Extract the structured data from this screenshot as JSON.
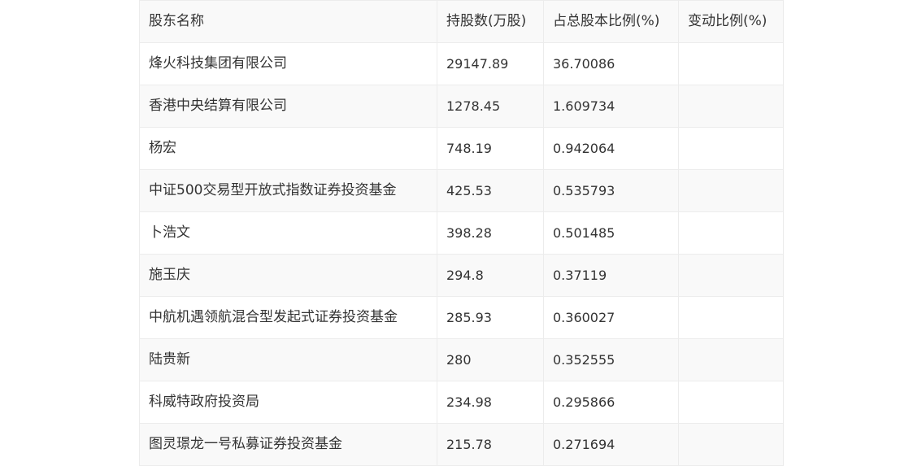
{
  "table": {
    "headers": [
      "股东名称",
      "持股数(万股)",
      "占总股本比例(%)",
      "变动比例(%)"
    ],
    "rows": [
      [
        "烽火科技集团有限公司",
        "29147.89",
        "36.70086",
        ""
      ],
      [
        "香港中央结算有限公司",
        "1278.45",
        "1.609734",
        ""
      ],
      [
        "杨宏",
        "748.19",
        "0.942064",
        ""
      ],
      [
        "中证500交易型开放式指数证券投资基金",
        "425.53",
        "0.535793",
        ""
      ],
      [
        "卜浩文",
        "398.28",
        "0.501485",
        ""
      ],
      [
        "施玉庆",
        "294.8",
        "0.37119",
        ""
      ],
      [
        "中航机遇领航混合型发起式证券投资基金",
        "285.93",
        "0.360027",
        ""
      ],
      [
        "陆贵新",
        "280",
        "0.352555",
        ""
      ],
      [
        "科威特政府投资局",
        "234.98",
        "0.295866",
        ""
      ],
      [
        "图灵璟龙一号私募证券投资基金",
        "215.78",
        "0.271694",
        ""
      ]
    ]
  }
}
